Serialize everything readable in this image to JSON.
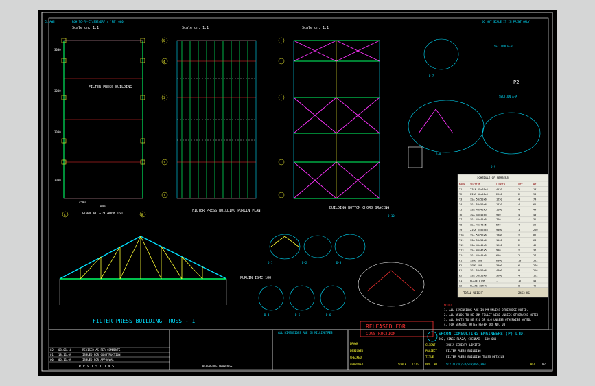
{
  "sheet": {
    "top_left_tag": "CL AWN",
    "drawing_no_top": "RCH-TC-FP-CY/SSE/DRF / 'RE' 000",
    "top_right_note": "DO NOT SCALE IT IN PRINT ONLY"
  },
  "plans": {
    "plan_a_scale": "Scale on: 1:1",
    "plan_b_scale": "Scale on: 1:1",
    "plan_c_scale": "Scale on: 1:1",
    "plan_a_label": "FILTER PRESS BUILDING",
    "plan_a_caption": "PLAN AT +19.400M LVL",
    "plan_b_caption": "FILTER PRESS BUILDING PURLIN PLAN",
    "plan_c_caption": "BUILDING BOTTOM CHORD BRACING",
    "row_labels": [
      "5",
      "4",
      "3",
      "2",
      "1"
    ],
    "col_labels": [
      "A",
      "B"
    ],
    "dim_bottom": "4500",
    "dim_total": "9000",
    "dims_left": [
      "3000",
      "3000",
      "3000",
      "3000",
      "3000"
    ]
  },
  "truss": {
    "title": "FILTER PRESS BUILDING TRUSS - 1",
    "note": "PURLIN ISMC 100"
  },
  "details": {
    "labels": [
      "D-1",
      "D-2",
      "D-3",
      "D-4",
      "D-5",
      "D-6",
      "D-7",
      "D-8",
      "D-9",
      "D-10"
    ],
    "p2": "P2",
    "section_a": "SECTION A-A",
    "section_b": "SECTION B-B"
  },
  "schedule": {
    "title": "SCHEDULE OF MEMBERS",
    "header": [
      "MARK",
      "SECTION",
      "LENGTH",
      "QTY",
      "WT"
    ],
    "rows": [
      [
        "T1",
        "2ISA 65x65x6",
        "4530",
        "2",
        "131"
      ],
      [
        "T2",
        "2ISA 50x50x6",
        "2200",
        "2",
        "98"
      ],
      [
        "T3",
        "ISA 50x50x6",
        "1650",
        "4",
        "74"
      ],
      [
        "T4",
        "ISA 50x50x6",
        "1420",
        "4",
        "62"
      ],
      [
        "T5",
        "ISA 45x45x5",
        "1100",
        "4",
        "44"
      ],
      [
        "T6",
        "ISA 45x45x5",
        "980",
        "4",
        "40"
      ],
      [
        "T7",
        "ISA 45x45x5",
        "760",
        "4",
        "31"
      ],
      [
        "T8",
        "ISA 45x45x5",
        "540",
        "4",
        "22"
      ],
      [
        "T9",
        "2ISA 65x65x6",
        "9000",
        "1",
        "260"
      ],
      [
        "T10",
        "ISA 50x50x6",
        "1800",
        "2",
        "81"
      ],
      [
        "T11",
        "ISA 50x50x6",
        "1500",
        "2",
        "68"
      ],
      [
        "T12",
        "ISA 45x45x5",
        "1200",
        "2",
        "49"
      ],
      [
        "T13",
        "ISA 45x45x5",
        "900",
        "2",
        "36"
      ],
      [
        "T14",
        "ISA 45x45x5",
        "650",
        "2",
        "27"
      ],
      [
        "P1",
        "ISMC 100",
        "6000",
        "10",
        "552"
      ],
      [
        "P2",
        "ISMC 100",
        "3000",
        "6",
        "276"
      ],
      [
        "B1",
        "ISA 50x50x6",
        "4800",
        "8",
        "216"
      ],
      [
        "B2",
        "ISA 50x50x6",
        "3600",
        "4",
        "162"
      ],
      [
        "S1",
        "PLATE 8THK",
        "-",
        "12",
        "48"
      ],
      [
        "S2",
        "PLATE 10THK",
        "-",
        "8",
        "42"
      ],
      [
        "S3",
        "PLATE 12THK",
        "-",
        "6",
        "36"
      ]
    ],
    "total_label": "TOTAL WEIGHT",
    "total": "2453 KG"
  },
  "notes": {
    "title": "NOTES",
    "lines": [
      "1. ALL DIMENSIONS ARE IN MM UNLESS OTHERWISE NOTED.",
      "2. ALL WELDS TO BE 6MM FILLET WELD UNLESS OTHERWISE NOTED.",
      "3. ALL BOLTS TO BE M16 GR 4.6 UNLESS OTHERWISE NOTED.",
      "4. FOR GENERAL NOTES REFER DRG NO. 00"
    ]
  },
  "released": {
    "line1": "RELEASED FOR",
    "line2": "CONSTRUCTION"
  },
  "revisions": {
    "header": [
      "REV",
      "DATE",
      "DESCRIPTION",
      "BY",
      "CHK",
      "APP"
    ],
    "rows": [
      [
        "02",
        "08.01.10",
        "REVISED AS PER COMMENTS",
        "",
        "",
        ""
      ],
      [
        "01",
        "18.11.09",
        "ISSUED FOR CONSTRUCTION",
        "",
        "",
        ""
      ],
      [
        "00",
        "06.11.09",
        "ISSUED FOR APPROVAL",
        "",
        "",
        ""
      ]
    ],
    "footer": "R E V I S I O N S",
    "ref_title": "REFERENCE DRAWINGS"
  },
  "title_block": {
    "company": "SRCON CONSULTING ENGINEERS (P) LTD.",
    "address": "202, KINGS PLAZA, CHENNAI - 600 040",
    "client_label": "CLIENT",
    "client": "INDIA CEMENTS LIMITED",
    "project_label": "PROJECT",
    "project": "FILTER PRESS BUILDING",
    "title_label": "TITLE",
    "title": "FILTER PRESS BUILDING TRUSS DETAILS",
    "drg_label": "DRG. NO.",
    "drg_no": "SC/ICL/TC/FP/STR/DRF/004",
    "rev_label": "REV.",
    "rev": "02",
    "scale_label": "SCALE",
    "scale": "1:75",
    "sign_rows": [
      "DRAWN",
      "DESIGNED",
      "CHECKED",
      "APPROVED"
    ],
    "approval_text": "ALL DIMENSIONS ARE IN MILLIMETRES",
    "stamp": "SRCON"
  }
}
